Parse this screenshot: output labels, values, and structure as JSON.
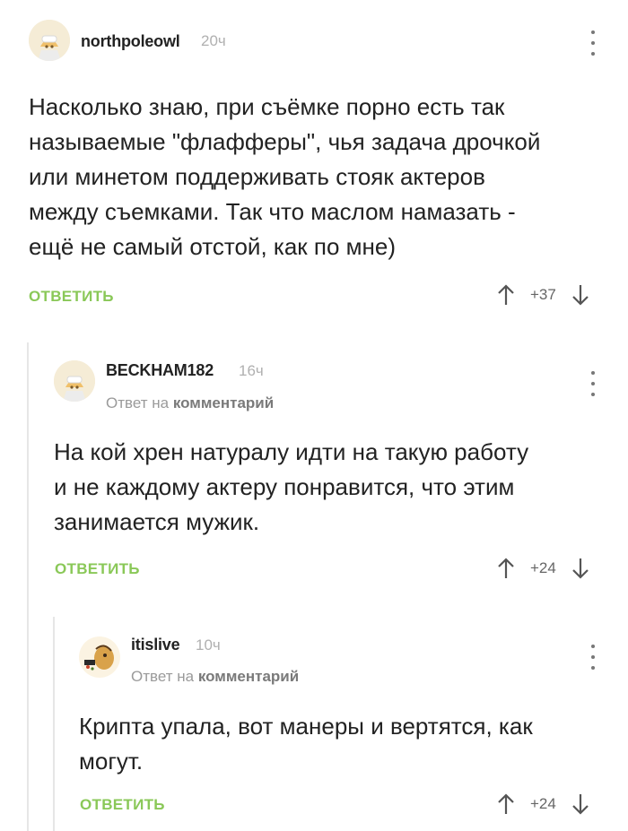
{
  "comments": [
    {
      "username": "northpoleowl",
      "time": "20ч",
      "text": [
        "Насколько знаю, при съёмке порно есть так",
        "называемые \"флафферы\", чья задача дрочкой",
        "или минетом поддерживать стояк актеров",
        "между съемками. Так что маслом намазать -",
        "ещё не самый отстой, как по мне)"
      ],
      "reply_label": "ОТВЕТИТЬ",
      "score": "+37"
    },
    {
      "username": "BECKHAM182",
      "time": "16ч",
      "reply_to_prefix": "Ответ на",
      "reply_to_target": "комментарий",
      "text": [
        "На кой хрен натуралу идти на такую работу",
        "и не каждому актеру понравится, что этим",
        "занимается мужик."
      ],
      "reply_label": "ОТВЕТИТЬ",
      "score": "+24"
    },
    {
      "username": "itislive",
      "time": "10ч",
      "reply_to_prefix": "Ответ на",
      "reply_to_target": "комментарий",
      "text": [
        "Крипта упала, вот манеры и вертятся, как",
        "могут."
      ],
      "reply_label": "ОТВЕТИТЬ",
      "score": "+24"
    }
  ],
  "colors": {
    "reply": "#8ac858",
    "thread_line": "#e6e6e6",
    "muted": "#b0b0b0"
  },
  "icons": {
    "upvote": "arrow-up-icon",
    "downvote": "arrow-down-icon",
    "more": "more-vertical-icon"
  }
}
